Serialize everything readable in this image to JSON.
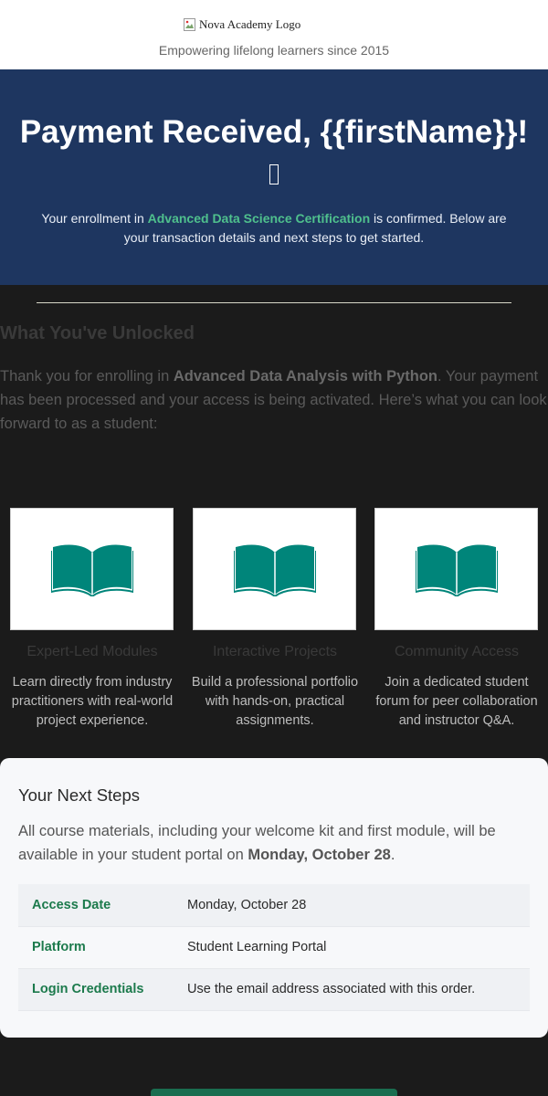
{
  "header": {
    "logo_alt": "Nova Academy Logo",
    "tagline": "Empowering lifelong learners since 2015"
  },
  "hero": {
    "title": "Payment Received, {{firstName}}!",
    "message_pre": "Your enrollment in ",
    "course_name": "Advanced Data Science Certification",
    "message_post": " is confirmed. Below are your transaction details and next steps to get started."
  },
  "unlocked": {
    "title": "What You've Unlocked",
    "text_pre": "Thank you for enrolling in ",
    "course_bold": "Advanced Data Analysis with Python",
    "text_post": ". Your payment has been processed and your access is being activated. Here’s what you can look forward to as a student:"
  },
  "features": [
    {
      "icon": "open-book-icon",
      "title": "Expert-Led Modules",
      "desc": "Learn directly from industry practitioners with real-world project experience."
    },
    {
      "icon": "open-book-icon",
      "title": "Interactive Projects",
      "desc": "Build a professional portfolio with hands-on, practical assignments."
    },
    {
      "icon": "open-book-icon",
      "title": "Community Access",
      "desc": "Join a dedicated student forum for peer collaboration and instructor Q&A."
    }
  ],
  "next_steps": {
    "title": "Your Next Steps",
    "intro_pre": "All course materials, including your welcome kit and first module, will be available in your student portal on ",
    "intro_date": "Monday, October 28",
    "intro_post": ".",
    "rows": [
      {
        "label": "Access Date",
        "value": "Monday, October 28"
      },
      {
        "label": "Platform",
        "value": "Student Learning Portal"
      },
      {
        "label": "Login Credentials",
        "value": "Use the email address associated with this order."
      }
    ]
  },
  "colors": {
    "hero_bg": "#1e3660",
    "accent_green": "#4fc08d",
    "label_green": "#1c7a4c",
    "icon_teal": "#00857a",
    "cta_green": "#1a6e50"
  }
}
